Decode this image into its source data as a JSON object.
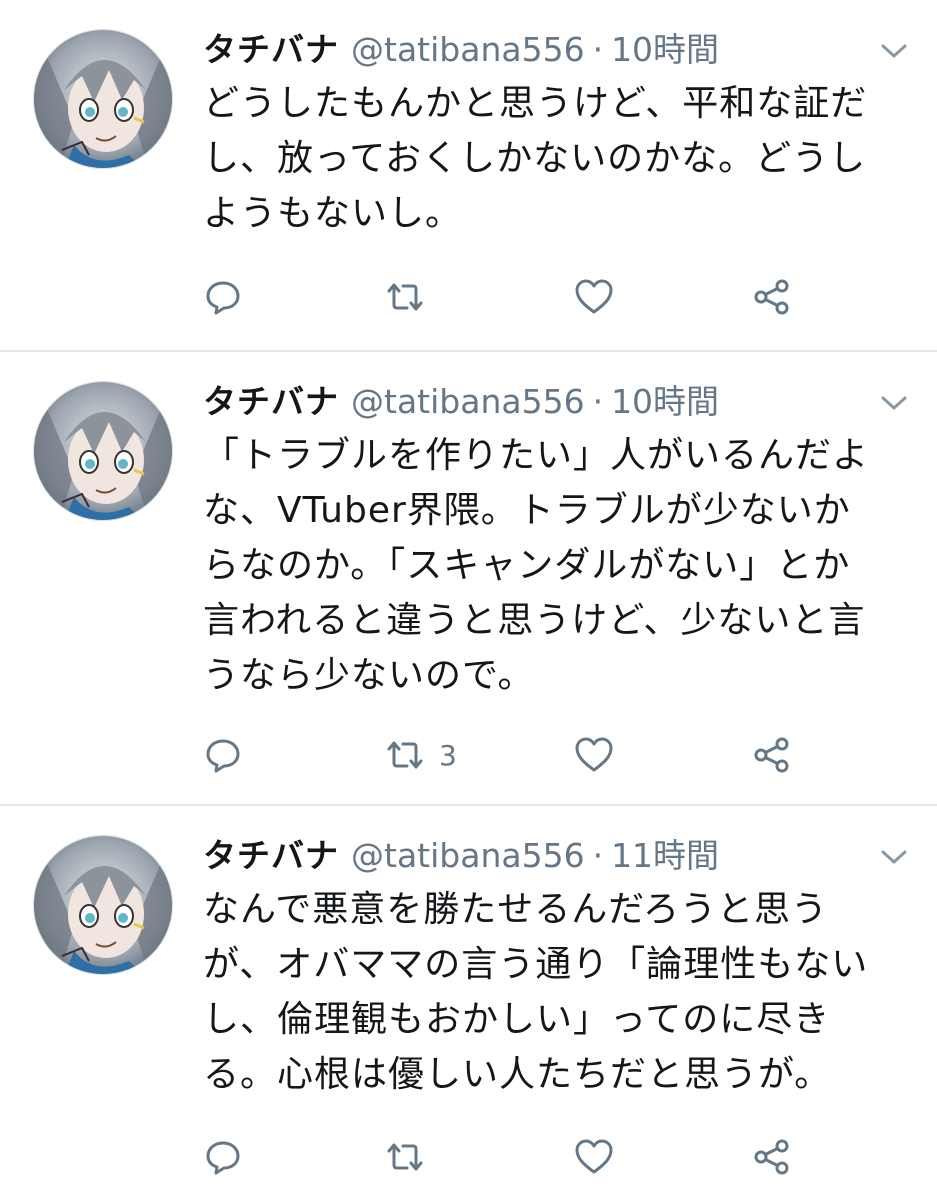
{
  "tweets": [
    {
      "author_name": "タチバナ",
      "author_handle": "@tatibana556",
      "separator": "·",
      "time": "10時間",
      "text": "どうしたもんかと思うけど、平和な証だ\nし、放っておくしかないのかな。どうし\nようもないし。",
      "retweet_count": ""
    },
    {
      "author_name": "タチバナ",
      "author_handle": "@tatibana556",
      "separator": "·",
      "time": "10時間",
      "text": "「トラブルを作りたい」人がいるんだよ\nな、VTuber界隈。トラブルが少ないか\nらなのか。「スキャンダルがない」とか\n言われると違うと思うけど、少ないと言\nうなら少ないので。",
      "retweet_count": "3"
    },
    {
      "author_name": "タチバナ",
      "author_handle": "@tatibana556",
      "separator": "·",
      "time": "11時間",
      "text": "なんで悪意を勝たせるんだろうと思う\nが、オバママの言う通り「論理性もない\nし、倫理観もおかしい」ってのに尽き\nる。心根は優しい人たちだと思うが。",
      "retweet_count": ""
    }
  ],
  "icons": {
    "reply": "reply-icon",
    "retweet": "retweet-icon",
    "like": "heart-icon",
    "share": "share-icon",
    "caret": "chevron-down-icon",
    "avatar": "avatar"
  },
  "colors": {
    "text": "#14171a",
    "secondary": "#657786",
    "icon": "#657786",
    "divider": "#e1e8ed"
  }
}
